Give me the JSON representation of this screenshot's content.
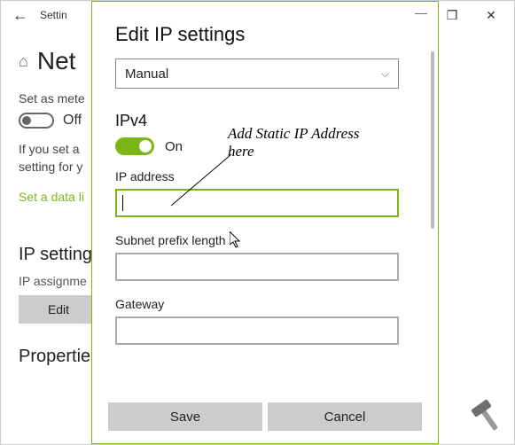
{
  "bg": {
    "title": "Settin",
    "heading": "Net",
    "metered_label": "Set as mete",
    "metered_state": "Off",
    "para": "If you set a\nsetting for y",
    "link": "Set a data li",
    "ip_section": "IP setting",
    "ip_assign": "IP assignme",
    "edit_btn": "Edit",
    "props_section": "Propertie",
    "controls": {
      "restore": "❐",
      "close": "✕"
    }
  },
  "dlg": {
    "title": "Edit IP settings",
    "select_value": "Manual",
    "ipv4_label": "IPv4",
    "ipv4_state": "On",
    "fields": {
      "ip_label": "IP address",
      "ip_value": "",
      "subnet_label": "Subnet prefix length",
      "subnet_value": "",
      "gateway_label": "Gateway",
      "gateway_value": ""
    },
    "save": "Save",
    "cancel": "Cancel",
    "minimize": "—"
  },
  "annotation": "Add Static IP Address here"
}
